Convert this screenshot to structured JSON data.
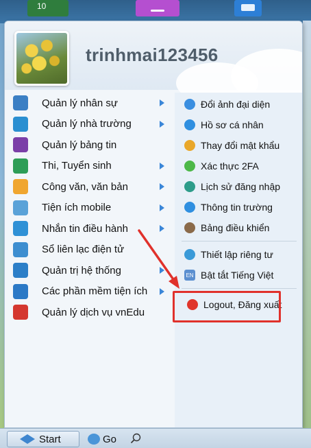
{
  "desktop": {
    "icon_badge": "10"
  },
  "user": {
    "username": "trinhmai123456"
  },
  "left_menu": [
    {
      "label": "Quản lý nhân sự",
      "has_submenu": true,
      "icon": "staff-icon",
      "color": "#3b7fc4"
    },
    {
      "label": "Quản lý nhà trường",
      "has_submenu": true,
      "icon": "school-icon",
      "color": "#2a8fd1"
    },
    {
      "label": "Quản lý bảng tin",
      "has_submenu": false,
      "icon": "news-icon",
      "color": "#7b3fa8"
    },
    {
      "label": "Thi, Tuyển sinh",
      "has_submenu": true,
      "icon": "exam-icon",
      "color": "#2e9d57"
    },
    {
      "label": "Công văn, văn bản",
      "has_submenu": true,
      "icon": "document-icon",
      "color": "#f0a630"
    },
    {
      "label": "Tiện ích mobile",
      "has_submenu": true,
      "icon": "mobile-icon",
      "color": "#5aa2d8"
    },
    {
      "label": "Nhắn tin điều hành",
      "has_submenu": true,
      "icon": "chat-icon",
      "color": "#2f91d6"
    },
    {
      "label": "Sổ liên lạc điện tử",
      "has_submenu": false,
      "icon": "contact-book-icon",
      "color": "#3d8ed0"
    },
    {
      "label": "Quản trị hệ thống",
      "has_submenu": true,
      "icon": "settings-icon",
      "color": "#2c7fc8"
    },
    {
      "label": "Các phần mềm tiện ích",
      "has_submenu": true,
      "icon": "apps-grid-icon",
      "color": "#2b79c6"
    },
    {
      "label": "Quản lý dịch vụ vnEdu",
      "has_submenu": false,
      "icon": "store-icon",
      "color": "#d4372f"
    }
  ],
  "right_menu": [
    {
      "label": "Đổi ảnh đại diện",
      "icon": "user-icon",
      "color": "#3a8ee0"
    },
    {
      "label": "Hồ sơ cá nhân",
      "icon": "info-icon",
      "color": "#2f8fe0"
    },
    {
      "label": "Thay đổi mật khẩu",
      "icon": "key-user-icon",
      "color": "#e9a72a"
    },
    {
      "label": "Xác thực 2FA",
      "icon": "shield-icon",
      "color": "#4cb848"
    },
    {
      "label": "Lịch sử đăng nhập",
      "icon": "history-icon",
      "color": "#2d9c8a"
    },
    {
      "label": "Thông tin trường",
      "icon": "info-icon",
      "color": "#2f8fe0"
    },
    {
      "label": "Bảng điều khiển",
      "icon": "admin-user-icon",
      "color": "#8a6a4a"
    }
  ],
  "right_menu_2": [
    {
      "label": "Thiết lập riêng tư",
      "icon": "privacy-icon",
      "color": "#3a9ad8"
    },
    {
      "label": "Bật tắt Tiếng Việt",
      "icon": "language-en-icon",
      "color": "#5b8fd0",
      "badge": "EN"
    }
  ],
  "logout": {
    "label": "Logout, Đăng xuất",
    "icon": "power-icon",
    "color": "#e0352b"
  },
  "taskbar": {
    "start_label": "Start",
    "go_label": "Go"
  }
}
